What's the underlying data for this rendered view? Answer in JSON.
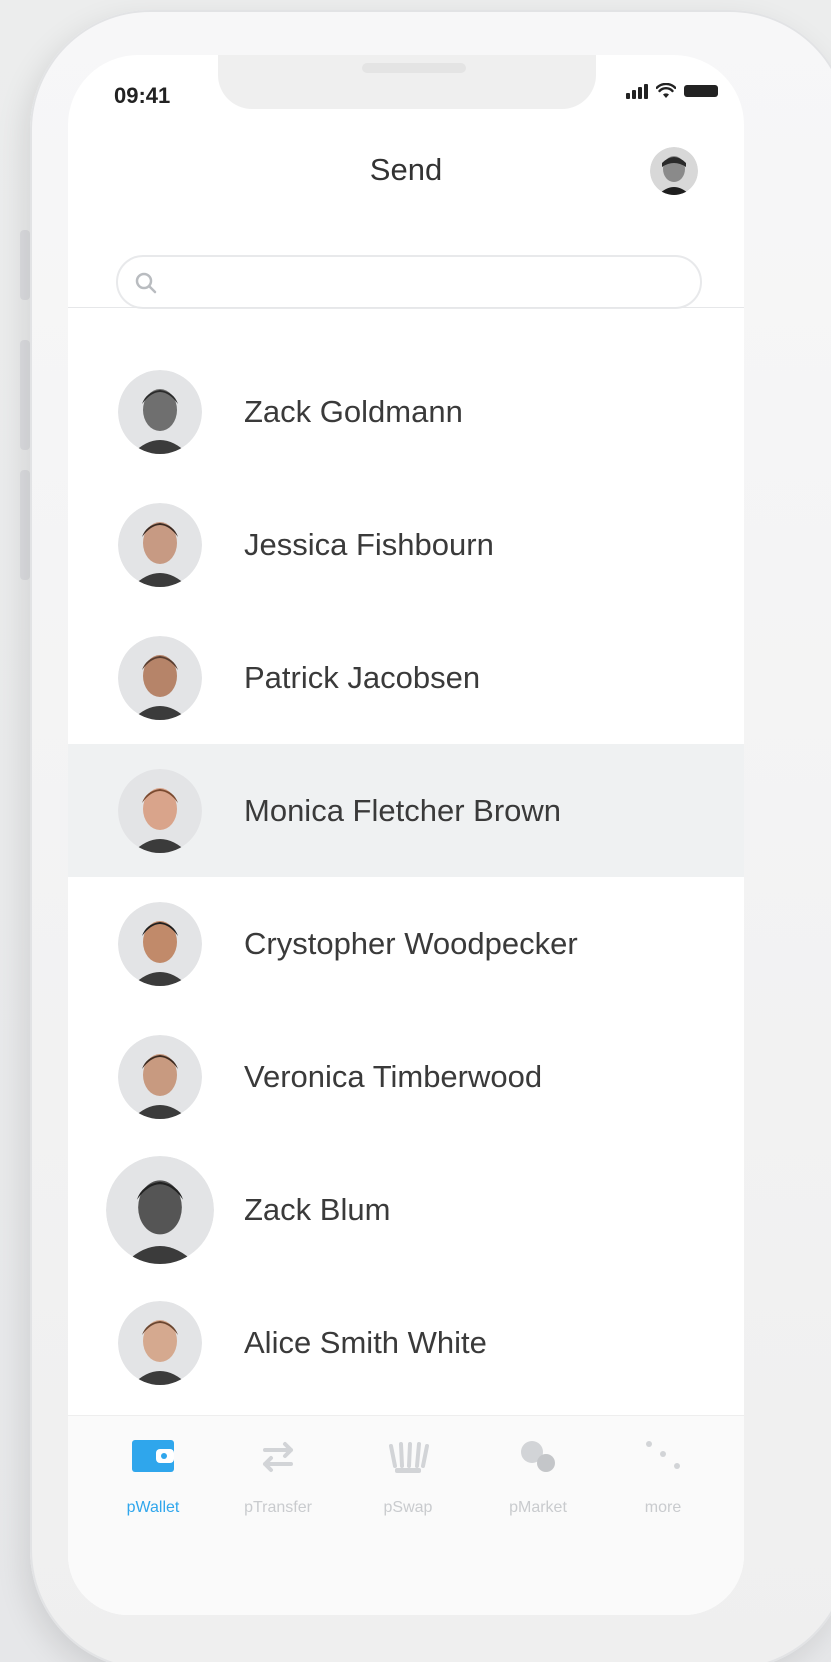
{
  "status_bar": {
    "time": "09:41"
  },
  "header": {
    "title": "Send"
  },
  "search": {
    "placeholder": "",
    "value": ""
  },
  "contacts": [
    {
      "name": "Zack Goldmann",
      "avatar_tone": "#6f6f6f",
      "hair": "#2b2b2b",
      "selected": false
    },
    {
      "name": "Jessica Fishbourn",
      "avatar_tone": "#c79a83",
      "hair": "#3b2a22",
      "selected": false
    },
    {
      "name": "Patrick Jacobsen",
      "avatar_tone": "#b68469",
      "hair": "#5a3e30",
      "selected": false
    },
    {
      "name": "Monica Fletcher Brown",
      "avatar_tone": "#d9a48b",
      "hair": "#7a4a30",
      "selected": true
    },
    {
      "name": "Crystopher Woodpecker",
      "avatar_tone": "#c18a6a",
      "hair": "#1f1f1f",
      "selected": false
    },
    {
      "name": "Veronica Timberwood",
      "avatar_tone": "#c89a80",
      "hair": "#3d2a1f",
      "selected": false
    },
    {
      "name": "Zack Blum",
      "avatar_tone": "#555555",
      "hair": "#222222",
      "selected": false
    },
    {
      "name": "Alice Smith White",
      "avatar_tone": "#d5a98f",
      "hair": "#6a4630",
      "selected": false
    }
  ],
  "tabbar": {
    "tabs": [
      {
        "label": "pWallet",
        "icon": "wallet-icon",
        "active": true
      },
      {
        "label": "pTransfer",
        "icon": "transfer-icon",
        "active": false
      },
      {
        "label": "pSwap",
        "icon": "swap-icon",
        "active": false
      },
      {
        "label": "pMarket",
        "icon": "market-icon",
        "active": false
      },
      {
        "label": "more",
        "icon": "more-icon",
        "active": false
      }
    ]
  },
  "colors": {
    "accent": "#2fa6ec",
    "selected_row": "#eff1f2",
    "text": "#3a3a3a"
  }
}
